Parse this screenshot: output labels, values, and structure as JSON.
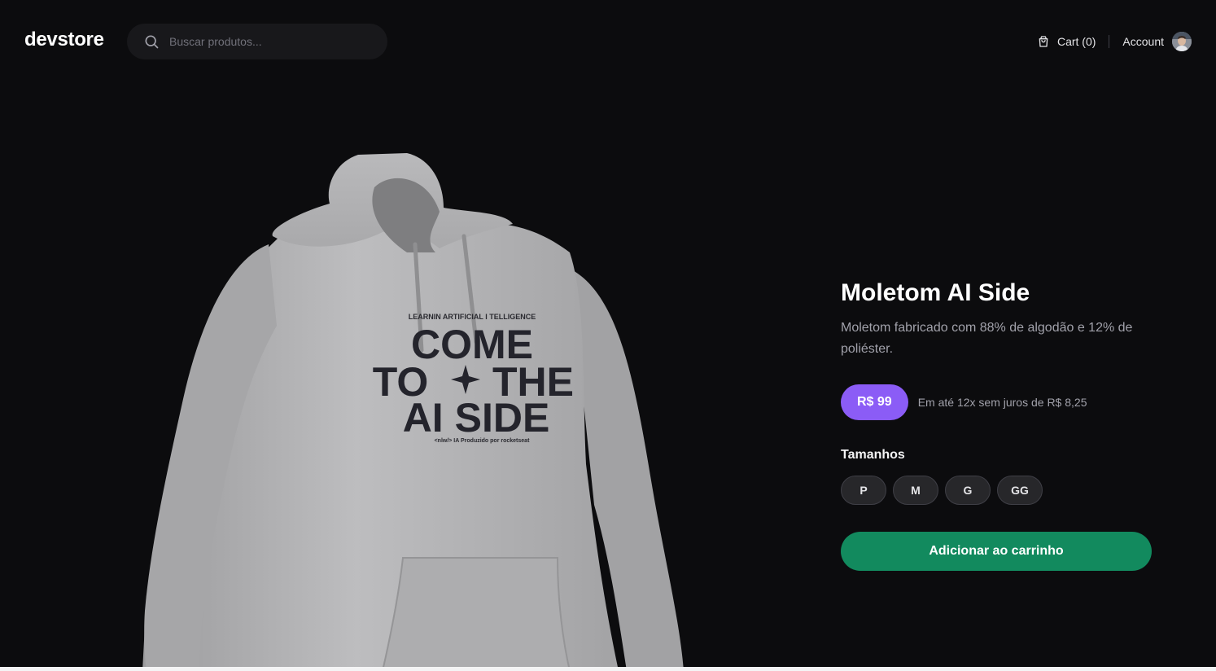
{
  "header": {
    "logo": "devstore",
    "search": {
      "placeholder": "Buscar produtos..."
    },
    "cart_label": "Cart (0)",
    "account_label": "Account"
  },
  "product": {
    "title": "Moletom AI Side",
    "description": "Moletom fabricado com 88% de algodão e 12% de poliéster.",
    "price": "R$ 99",
    "installments": "Em até 12x sem juros de R$ 8,25",
    "sizes_label": "Tamanhos",
    "sizes": [
      "P",
      "M",
      "G",
      "GG"
    ],
    "add_to_cart_label": "Adicionar ao carrinho",
    "print": {
      "top_line": "LEARNIN   ARTIFICIAL  I  TELLIGENCE",
      "line1": "COME",
      "line2": "TO",
      "line2b": "THE",
      "line3": "AI SIDE",
      "footer": "<nlw/> IA  Produzido por  rocketseat"
    }
  },
  "colors": {
    "background": "#0c0c0e",
    "price_badge": "#8b5cf6",
    "add_to_cart": "#128a5e",
    "hoodie": "#b4b4b6"
  },
  "icons": {
    "search": "search-icon",
    "cart": "shopping-bag-icon",
    "avatar": "user-avatar"
  }
}
